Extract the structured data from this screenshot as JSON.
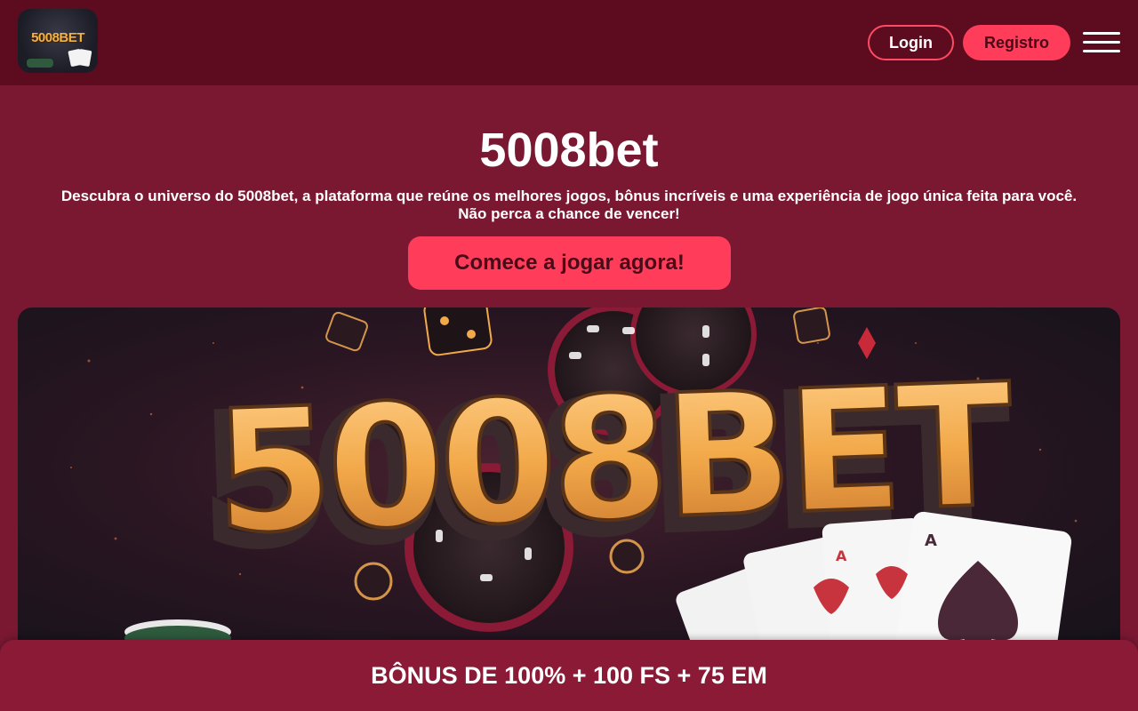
{
  "header": {
    "logo_text": "5008BET",
    "login_label": "Login",
    "register_label": "Registro",
    "menu_icon": "hamburger-menu-icon"
  },
  "hero": {
    "title": "5008bet",
    "description_line1": "Descubra o universo do 5008bet, a plataforma que reúne os melhores jogos, bônus incríveis e uma experiência de jogo única feita para você.",
    "description_line2": "Não perca a chance de vencer!",
    "cta_label": "Comece a jogar agora!"
  },
  "banner": {
    "text": "5008BET"
  },
  "bonus_bar": {
    "text": "BÔNUS DE 100% + 100 FS + 75 EM"
  },
  "colors": {
    "header_bg": "#5c0c1e",
    "page_bg": "#7a1832",
    "accent": "#ff3d5a",
    "bonus_bg": "#8a1a36",
    "banner_text": "#f2a94a"
  }
}
